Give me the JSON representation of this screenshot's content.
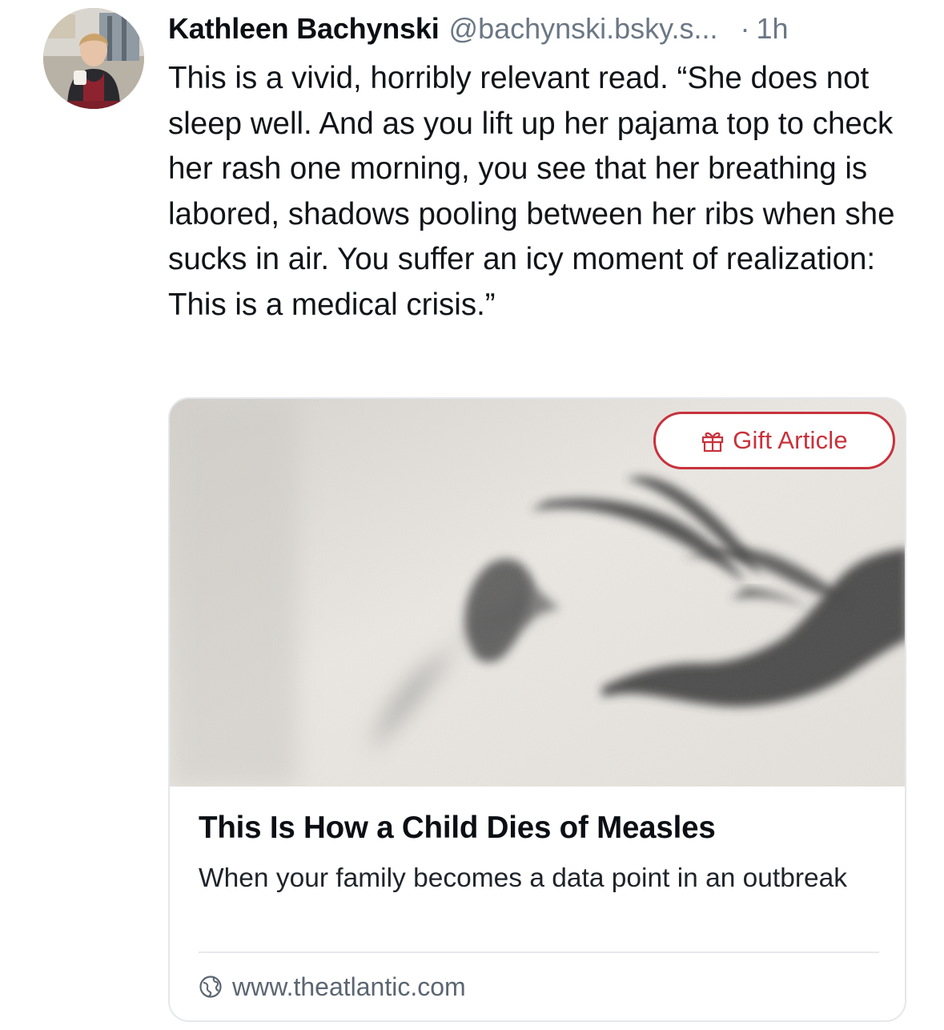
{
  "post": {
    "author": {
      "display_name": "Kathleen Bachynski",
      "handle": "@bachynski.bsky.s...",
      "avatar_icon": "avatar-photo"
    },
    "separator": "·",
    "timestamp": "1h",
    "text": "This is a vivid, horribly relevant read. “She does not sleep well. And as you lift up her pajama top to check her rash one morning, you see that her breathing is labored, shadows pooling between her ribs when she sucks in air. You suffer an icy moment of realization: This is a medical crisis.”"
  },
  "link_card": {
    "image_icon": "hand-shadow-image",
    "gift_button": {
      "label": "Gift Article",
      "icon": "gift-icon",
      "color": "#c8323c"
    },
    "title": "This Is How a Child Dies of Measles",
    "description": "When your family becomes a data point in an outbreak",
    "domain": "www.theatlantic.com",
    "domain_icon": "globe-icon"
  },
  "colors": {
    "text": "#111418",
    "muted": "#6b7785",
    "border": "#e4e7eb",
    "accent": "#c8323c"
  }
}
